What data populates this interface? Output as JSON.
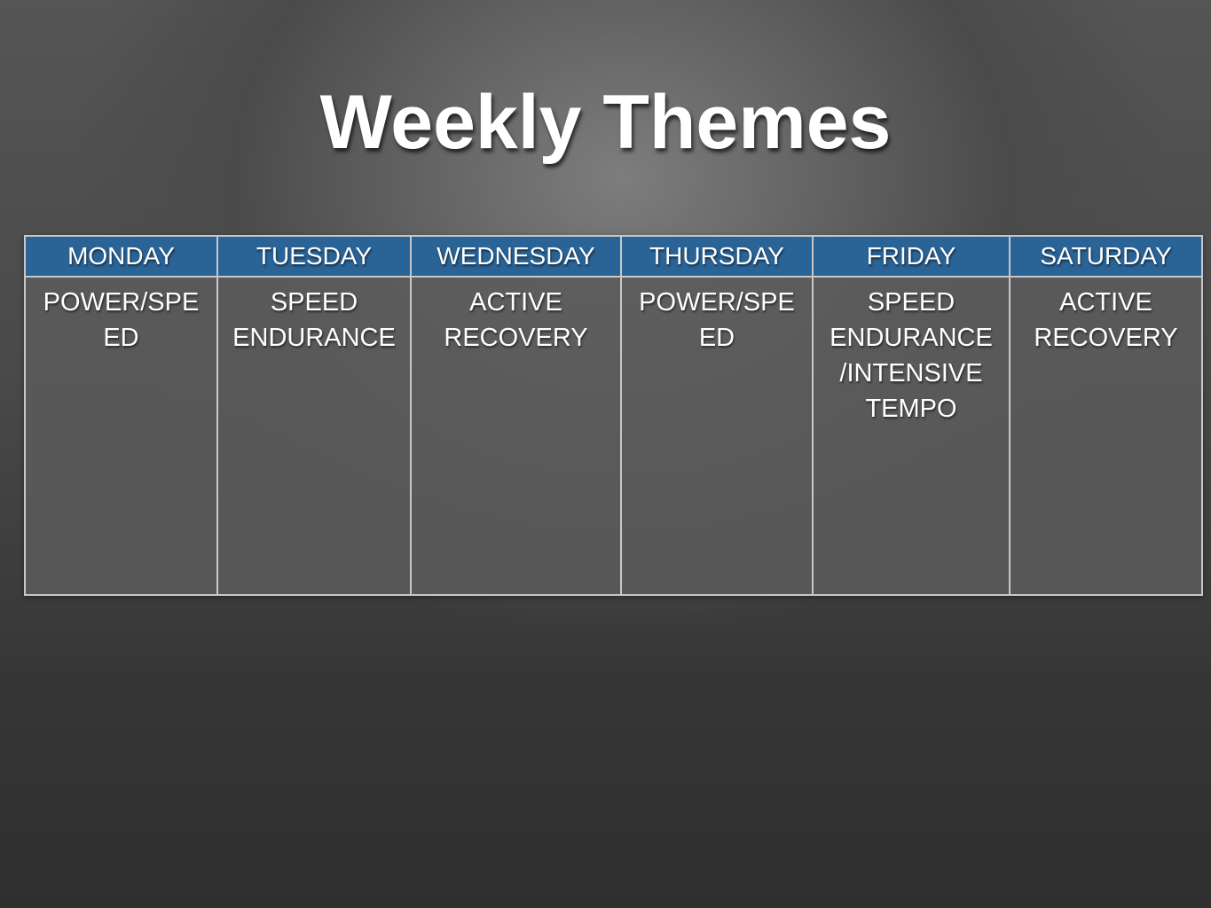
{
  "slide": {
    "title": "Weekly Themes",
    "colors": {
      "header_bg": "#2a6396",
      "text": "#ffffff",
      "grid": "#c8c8c8"
    }
  },
  "schedule": {
    "columns": [
      {
        "day": "MONDAY",
        "theme_lines": [
          "POWER/SPE",
          "ED"
        ]
      },
      {
        "day": "TUESDAY",
        "theme_lines": [
          "SPEED",
          "ENDURANCE"
        ]
      },
      {
        "day": "WEDNESDAY",
        "theme_lines": [
          "ACTIVE",
          "RECOVERY"
        ]
      },
      {
        "day": "THURSDAY",
        "theme_lines": [
          "POWER/SPE",
          "ED"
        ]
      },
      {
        "day": "FRIDAY",
        "theme_lines": [
          "SPEED",
          "ENDURANCE",
          "/INTENSIVE",
          "TEMPO"
        ]
      },
      {
        "day": "SATURDAY",
        "theme_lines": [
          "ACTIVE",
          "RECOVERY"
        ]
      }
    ]
  }
}
